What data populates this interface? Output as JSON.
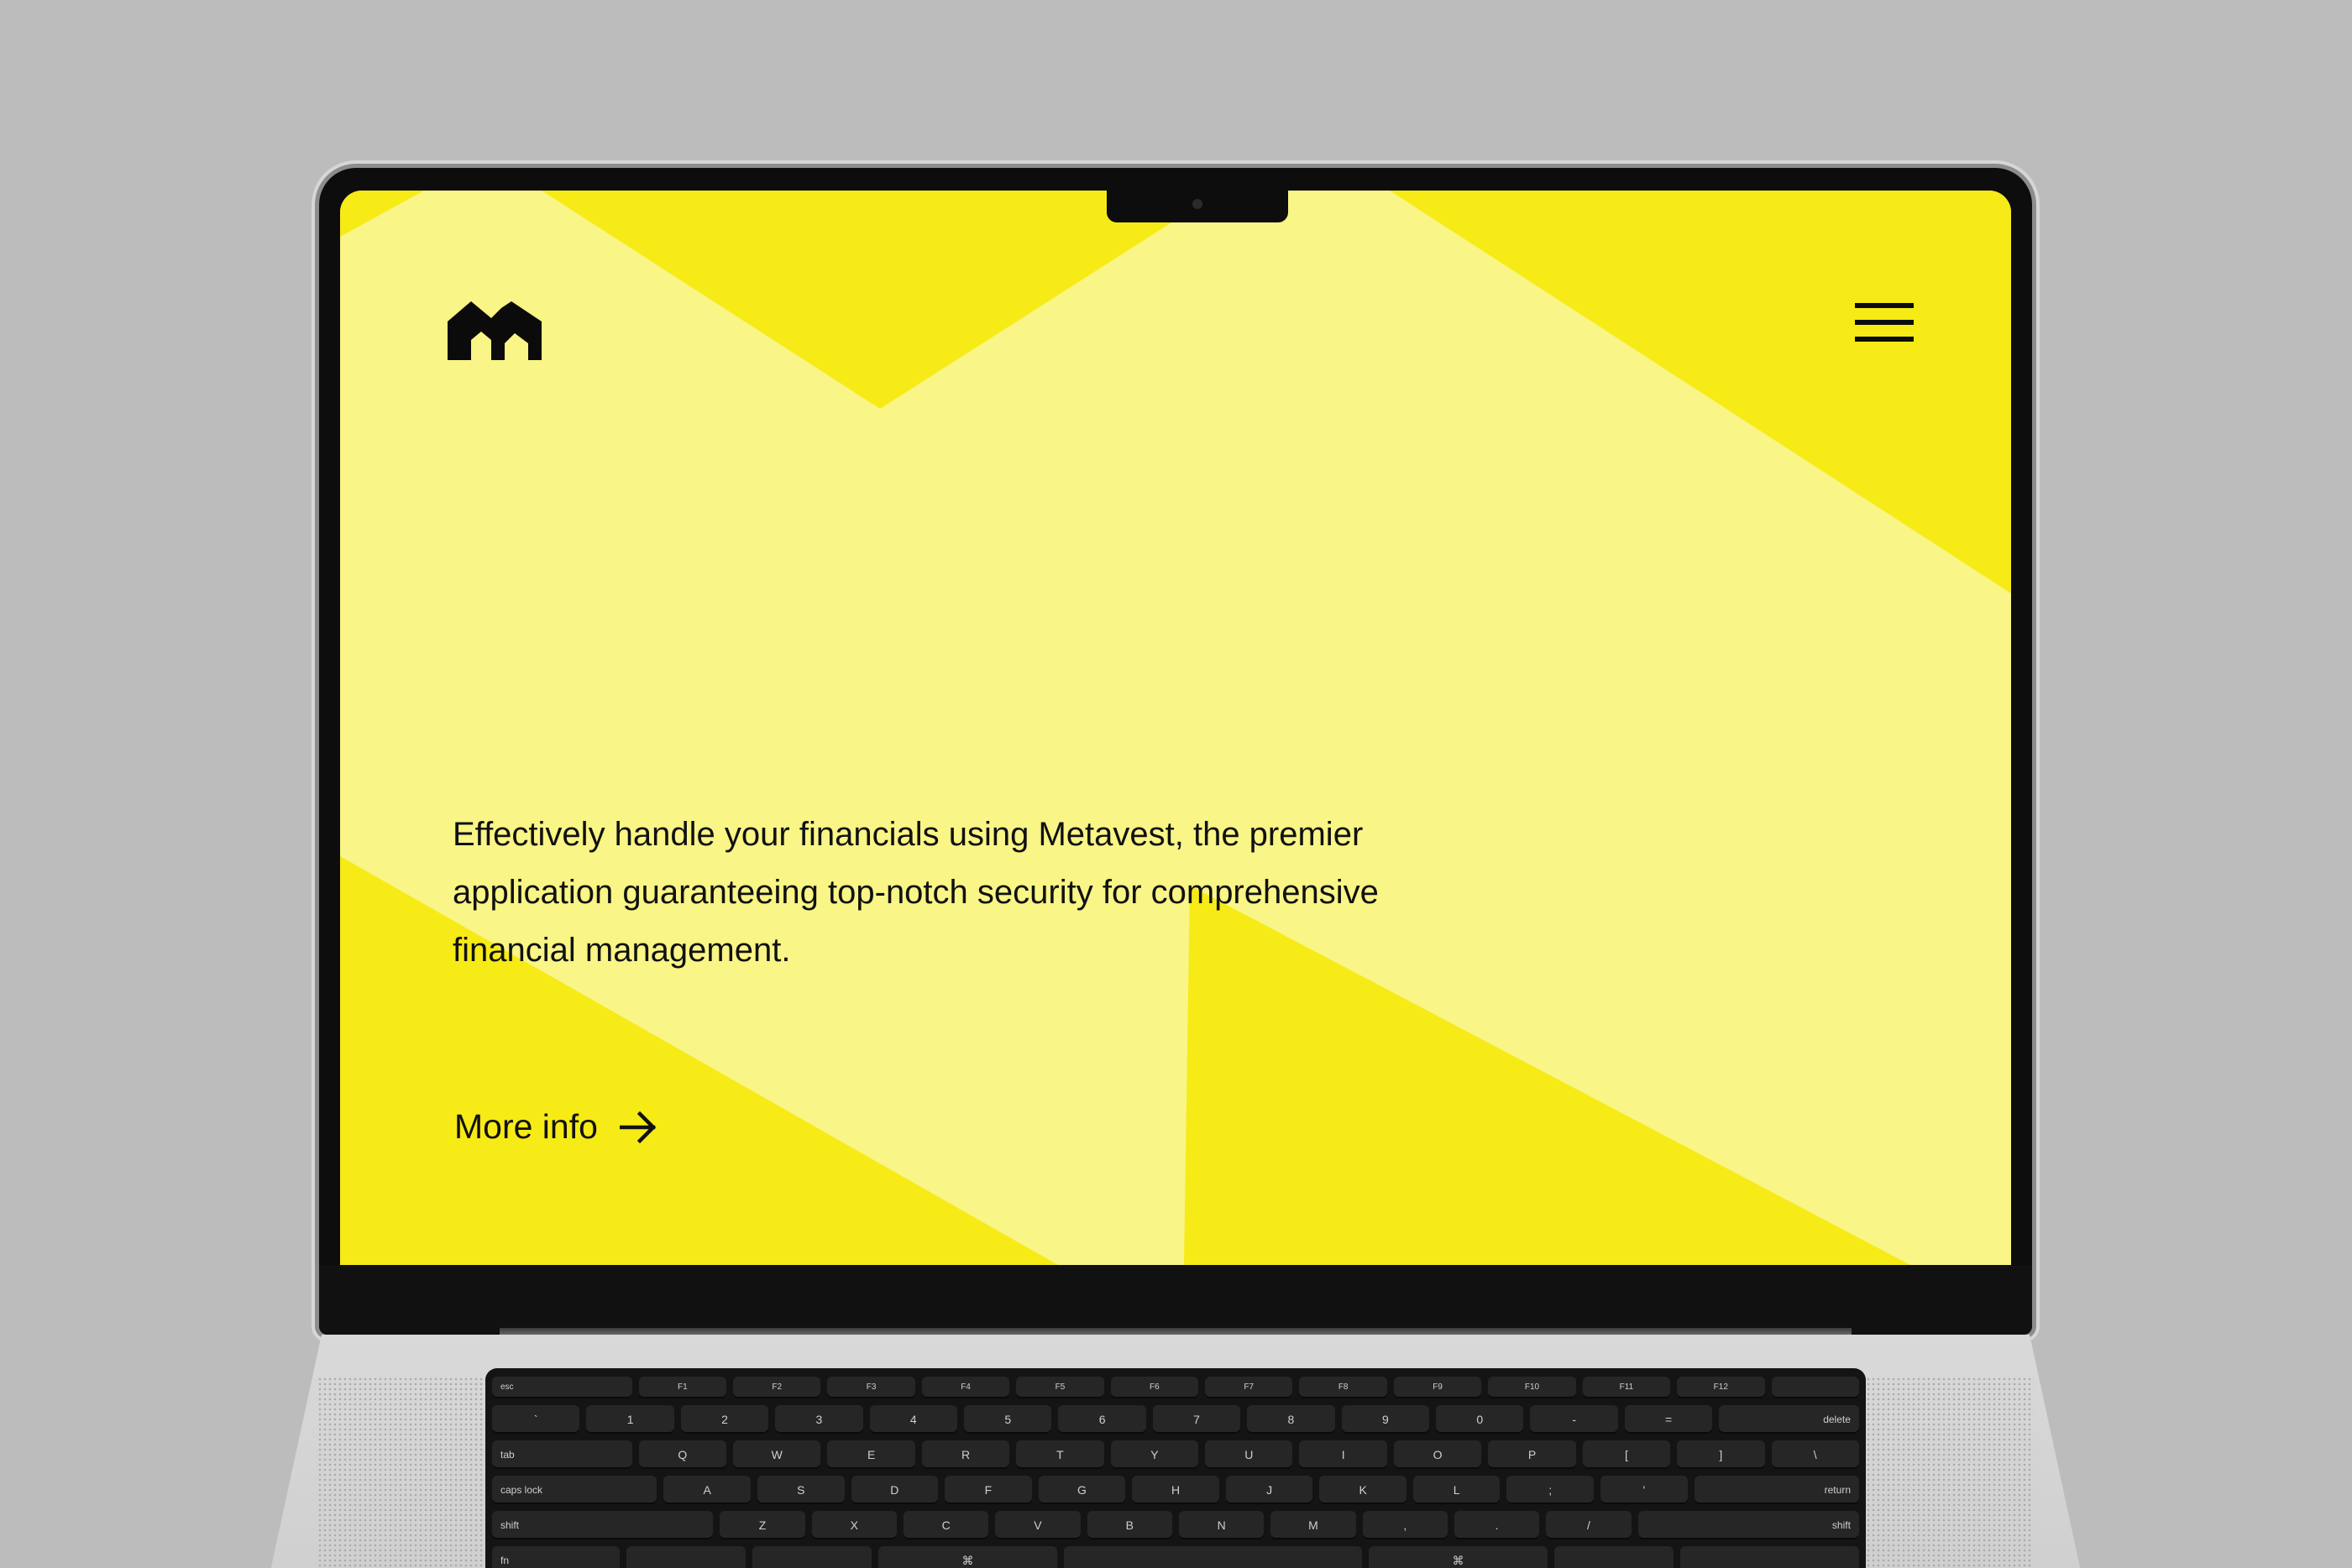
{
  "colors": {
    "backdrop": "#bcbcbc",
    "screen_light_yellow": "#f9f586",
    "screen_bright_yellow": "#f6eb16",
    "text": "#111111"
  },
  "header": {
    "logo_icon": "metavest-m-logo-icon",
    "menu_icon": "hamburger-menu-icon"
  },
  "hero": {
    "headline": "Effectively handle your financials using Metavest, the premier application guaranteeing top-notch security for comprehensive financial management.",
    "cta_label": "More info",
    "cta_icon": "arrow-right-icon"
  },
  "keyboard": {
    "rows": [
      [
        "esc",
        "F1",
        "F2",
        "F3",
        "F4",
        "F5",
        "F6",
        "F7",
        "F8",
        "F9",
        "F10",
        "F11",
        "F12",
        ""
      ],
      [
        "`",
        "1",
        "2",
        "3",
        "4",
        "5",
        "6",
        "7",
        "8",
        "9",
        "0",
        "-",
        "=",
        "delete"
      ],
      [
        "tab",
        "Q",
        "W",
        "E",
        "R",
        "T",
        "Y",
        "U",
        "I",
        "O",
        "P",
        "[",
        "]",
        "\\"
      ],
      [
        "caps lock",
        "A",
        "S",
        "D",
        "F",
        "G",
        "H",
        "J",
        "K",
        "L",
        ";",
        "'",
        "return"
      ],
      [
        "shift",
        "Z",
        "X",
        "C",
        "V",
        "B",
        "N",
        "M",
        ",",
        ".",
        "/",
        "shift"
      ],
      [
        "fn",
        "",
        "",
        "⌘",
        "",
        "⌘",
        "",
        ""
      ]
    ]
  }
}
